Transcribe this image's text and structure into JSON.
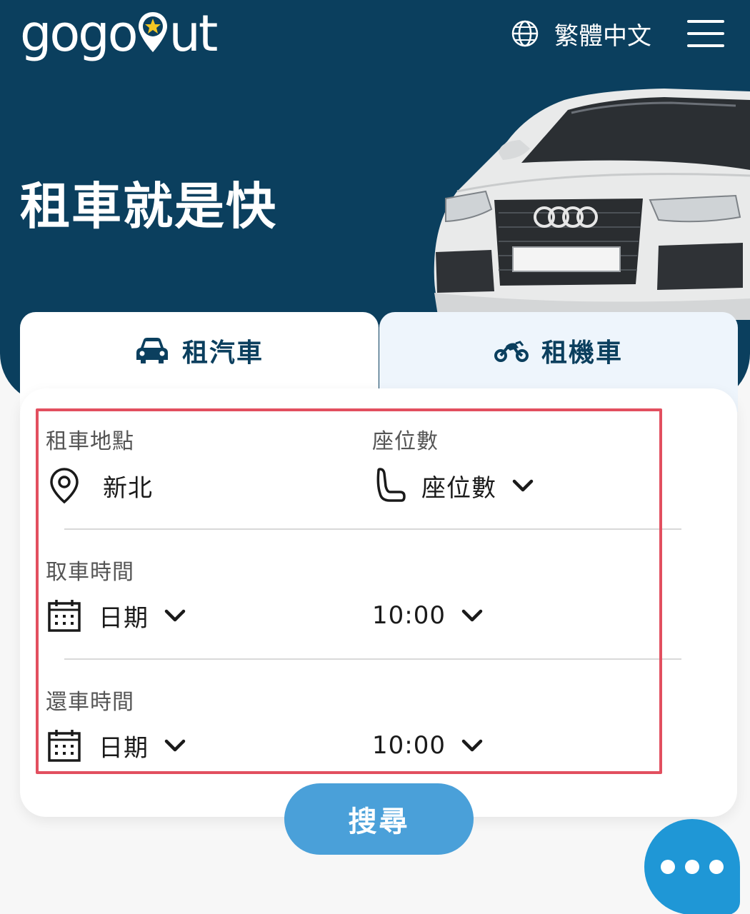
{
  "header": {
    "logo_text_before": "gogo",
    "logo_text_after": "ut",
    "language_label": "繁體中文",
    "icons": {
      "language": "globe-icon",
      "menu": "hamburger-menu-icon",
      "logo_mark": "map-pin-star-icon"
    }
  },
  "hero": {
    "title": "租車就是快"
  },
  "tabs": [
    {
      "label": "租汽車",
      "icon": "car-icon",
      "active": true
    },
    {
      "label": "租機車",
      "icon": "motorcycle-icon",
      "active": false
    }
  ],
  "form": {
    "location": {
      "label": "租車地點",
      "value": "新北",
      "icon": "location-pin-icon"
    },
    "seats": {
      "label": "座位數",
      "value": "座位數",
      "icon": "car-seat-icon"
    },
    "pickup": {
      "label": "取車時間",
      "date_value": "日期",
      "time_value": "10:00",
      "icon": "calendar-icon"
    },
    "return": {
      "label": "還車時間",
      "date_value": "日期",
      "time_value": "10:00",
      "icon": "calendar-icon"
    }
  },
  "search_button": {
    "label": "搜尋"
  },
  "chat_button": {
    "icon": "chat-dots-icon"
  },
  "colors": {
    "hero_bg": "#0b3f5e",
    "accent_blue": "#4aa0d9",
    "chat_blue": "#1f97d6",
    "highlight_red": "#e24f5f",
    "inactive_tab_bg": "#eef5fc"
  }
}
